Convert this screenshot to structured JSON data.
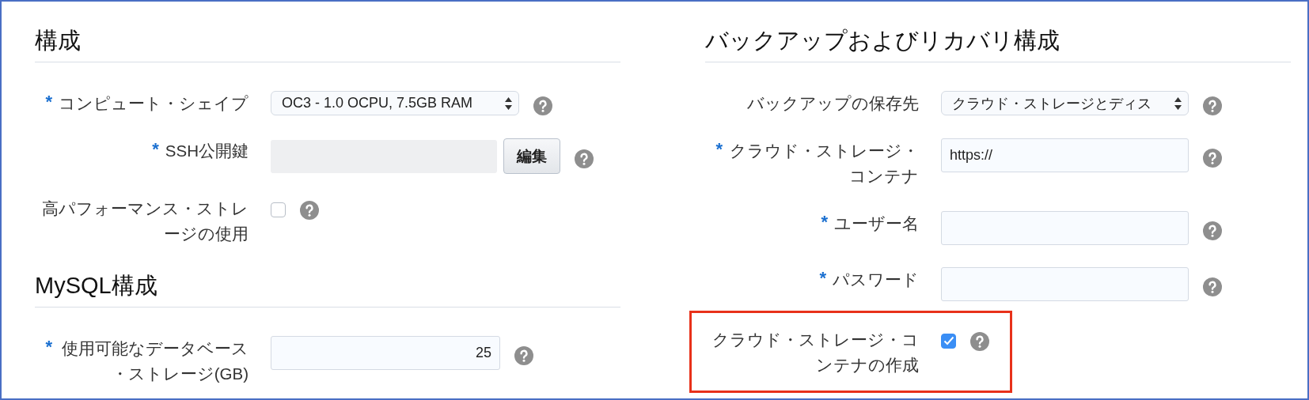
{
  "columns": [
    {
      "sections": [
        {
          "title": "構成",
          "fields": [
            {
              "kind": "select",
              "marker": "*",
              "label": "コンピュート・シェイプ",
              "value": "OC3 - 1.0 OCPU, 7.5GB RAM"
            },
            {
              "kind": "file",
              "marker": "*",
              "label": "SSH公開鍵",
              "button": "編集"
            },
            {
              "kind": "checkbox",
              "label": "高パフォーマンス・ストレージの使用",
              "checked": false
            }
          ]
        },
        {
          "title": "MySQL構成",
          "fields": [
            {
              "kind": "number",
              "marker": "*",
              "label": "使用可能なデータベース・ストレージ(GB)",
              "value": "25"
            }
          ]
        }
      ]
    },
    {
      "sections": [
        {
          "title": "バックアップおよびリカバリ構成",
          "fields": [
            {
              "kind": "select",
              "label": "バックアップの保存先",
              "value": "クラウド・ストレージとディス"
            },
            {
              "kind": "text",
              "marker": "*",
              "label": "クラウド・ストレージ・コンテナ",
              "value": "https://"
            },
            {
              "kind": "text",
              "marker": "*",
              "label": "ユーザー名"
            },
            {
              "kind": "text",
              "marker": "*",
              "label": "パスワード"
            },
            {
              "kind": "checkbox",
              "label": "クラウド・ストレージ・コンテナの作成",
              "checked": true,
              "highlighted": true
            }
          ]
        }
      ]
    }
  ]
}
